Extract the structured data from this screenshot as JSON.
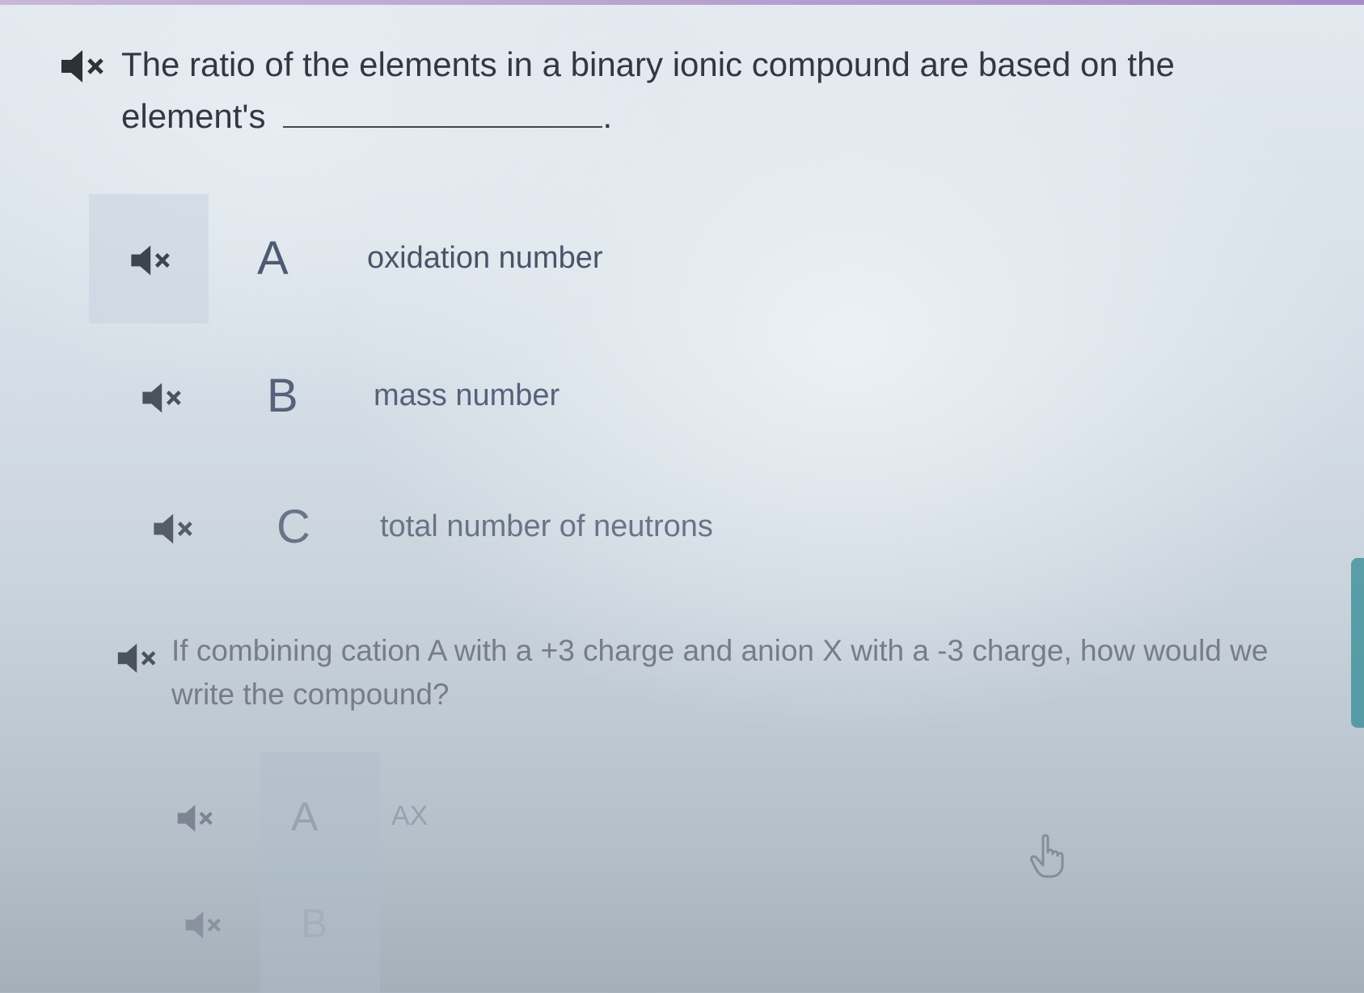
{
  "colors": {
    "text_dark": "#333840",
    "choice_text": "#4a5468",
    "top_bar": "#a78bc9",
    "right_accent": "#3c8f9a"
  },
  "question1": {
    "icon": "speaker-muted-icon",
    "text": "The ratio of the elements in a binary ionic compound are based on the element's",
    "blank_suffix": ".",
    "choices": [
      {
        "icon": "speaker-muted-icon",
        "letter": "A",
        "text": "oxidation number"
      },
      {
        "icon": "speaker-muted-icon",
        "letter": "B",
        "text": "mass number"
      },
      {
        "icon": "speaker-muted-icon",
        "letter": "C",
        "text": "total number of neutrons"
      }
    ]
  },
  "question2": {
    "icon": "speaker-muted-icon",
    "text": "If combining cation A with a +3 charge and anion X with a -3 charge, how would we write the compound?",
    "choices": [
      {
        "icon": "speaker-muted-icon",
        "letter": "A",
        "text": "AX"
      },
      {
        "icon": "speaker-muted-icon",
        "letter": "B",
        "text": ""
      }
    ]
  },
  "cursor": {
    "icon": "hand-pointer-icon"
  }
}
